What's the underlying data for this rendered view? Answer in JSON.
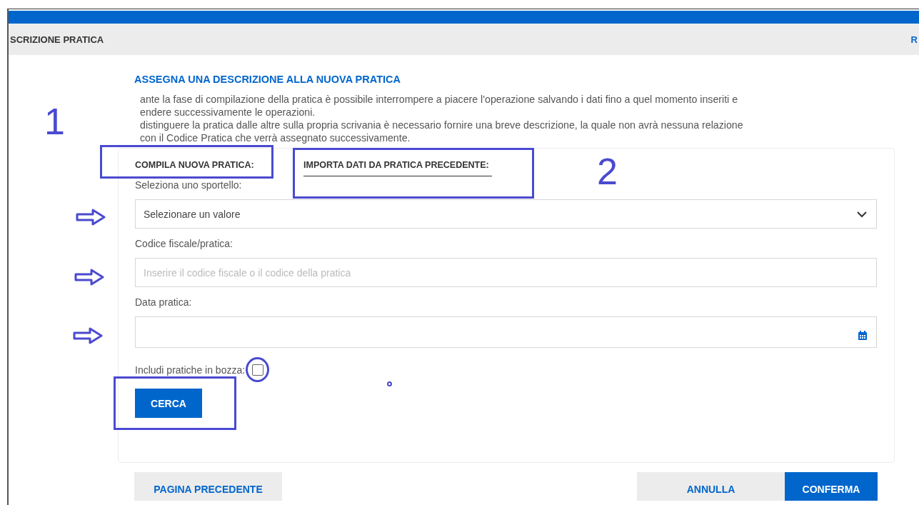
{
  "header": {
    "title": "SCRIZIONE PRATICA",
    "link": "R"
  },
  "section_title": "ASSEGNA UNA DESCRIZIONE ALLA NUOVA PRATICA",
  "intro_lines": [
    "ante la fase di compilazione della pratica è possibile interrompere a piacere l'operazione salvando i dati fino a quel momento inseriti e",
    "endere successivamente le operazioni.",
    "distinguere la pratica dalle altre sulla propria scrivania è necessario fornire una breve descrizione, la quale non avrà nessuna relazione",
    "con il Codice Pratica che verrà assegnato successivamente."
  ],
  "tabs": [
    {
      "label": "COMPILA NUOVA PRATICA:",
      "selected": false
    },
    {
      "label": "IMPORTA DATI DA PRATICA PRECEDENTE:",
      "selected": true
    }
  ],
  "fields": [
    {
      "kind": "select",
      "label": "Seleziona uno sportello:",
      "value": "Selezionare un valore"
    },
    {
      "kind": "text",
      "label": "Codice fiscale/pratica:",
      "placeholder": "Inserire il codice fiscale o il codice della pratica"
    },
    {
      "kind": "date",
      "label": "Data pratica:"
    }
  ],
  "draft_checkbox": {
    "label": "Includi pratiche in bozza:",
    "checked": false
  },
  "search_button": "CERCA",
  "footer": {
    "back": "PAGINA PRECEDENTE",
    "cancel": "ANNULLA",
    "confirm": "CONFERMA"
  },
  "annotations": {
    "numbers": [
      "1",
      "2"
    ]
  }
}
